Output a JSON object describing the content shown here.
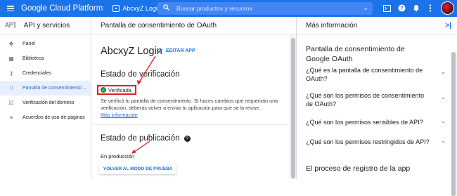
{
  "topbar": {
    "brand": "Google Cloud Platform",
    "project": "AbcxyZ Login",
    "search_placeholder": "Buscar productos y recursos",
    "colors": {
      "bar": "#1a73e8",
      "search": "#4285f4"
    }
  },
  "sidebar": {
    "logo": "API",
    "title": "API y servicios",
    "items": [
      {
        "icon": "dashboard-icon",
        "label": "Panel"
      },
      {
        "icon": "library-icon",
        "label": "Biblioteca"
      },
      {
        "icon": "key-icon",
        "label": "Credenciales"
      },
      {
        "icon": "consent-icon",
        "label": "Pantalla de consentimiento ...",
        "active": true
      },
      {
        "icon": "domain-check-icon",
        "label": "Verificación del dominio"
      },
      {
        "icon": "agreements-icon",
        "label": "Acuerdos de uso de páginas"
      }
    ]
  },
  "main": {
    "header": "Pantalla de consentimiento de OAuth",
    "app_name": "AbcxyZ Login",
    "edit_label": "EDITAR APP",
    "verification": {
      "heading": "Estado de verificación",
      "status": "Verificada",
      "description": "Se verificó tu pantalla de consentimiento. Si haces cambios que requerirán una verificación, deberás volver a enviar tu aplicación para que se la revise.",
      "more_link": "Más información"
    },
    "publishing": {
      "heading": "Estado de publicación",
      "status": "En producción",
      "button": "VOLVER AL MODO DE PRUEBA"
    }
  },
  "info_panel": {
    "header": "Más información",
    "title": "Pantalla de consentimiento de Google OAuth",
    "faqs": [
      "¿Qué es la pantalla de consentimiento de OAuth?",
      "¿Qué son los permisos de consentimiento de OAuth?",
      "¿Qué son los permisos sensibles de API?",
      "¿Qué son los permisos restringidos de API?"
    ],
    "section2": "El proceso de registro de la app"
  },
  "colors": {
    "accent": "#1a73e8",
    "highlight": "#e0201e",
    "verified": "#1e8e3e"
  }
}
